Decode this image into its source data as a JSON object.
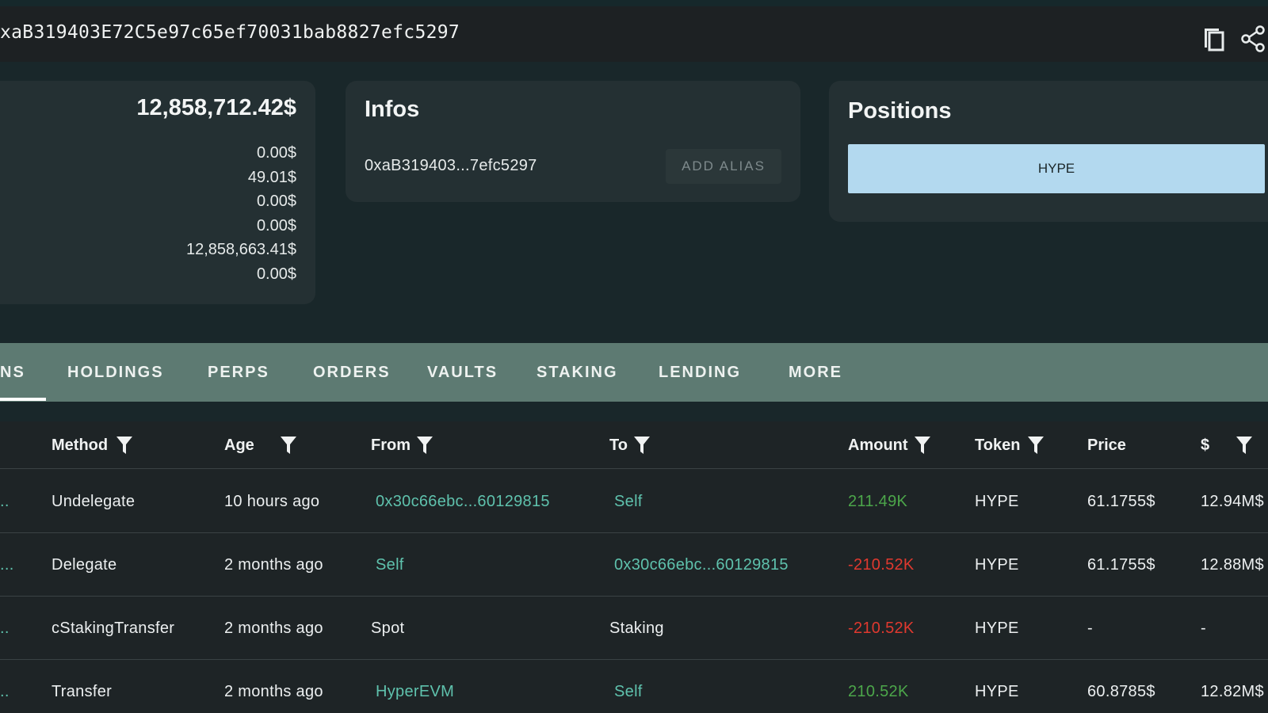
{
  "header": {
    "address": "xaB319403E72C5e97c65ef70031bab8827efc5297",
    "copy_icon": "copy-icon",
    "share_icon": "share-icon"
  },
  "balances": {
    "total": "12,858,712.42$",
    "lines": [
      "0.00$",
      "49.01$",
      "0.00$",
      "0.00$",
      "12,858,663.41$",
      "0.00$"
    ]
  },
  "infos": {
    "title": "Infos",
    "address_short": "0xaB319403...7efc5297",
    "add_alias_label": "ADD ALIAS"
  },
  "positions": {
    "title": "Positions",
    "items": [
      "HYPE"
    ]
  },
  "tabs": [
    {
      "label": "NS",
      "active": true
    },
    {
      "label": "HOLDINGS",
      "active": false
    },
    {
      "label": "PERPS",
      "active": false
    },
    {
      "label": "ORDERS",
      "active": false
    },
    {
      "label": "VAULTS",
      "active": false
    },
    {
      "label": "STAKING",
      "active": false
    },
    {
      "label": "LENDING",
      "active": false
    },
    {
      "label": "MORE",
      "active": false
    }
  ],
  "table": {
    "columns": [
      "Method",
      "Age",
      "From",
      "To",
      "Amount",
      "Token",
      "Price",
      "$"
    ],
    "rows": [
      {
        "hash": "..",
        "method": "Undelegate",
        "age": "10 hours ago",
        "from": "0x30c66ebc...60129815",
        "to": "Self",
        "amount": "211.49K",
        "token": "HYPE",
        "price": "61.1755$",
        "usd": "12.94M$"
      },
      {
        "hash": "...",
        "method": "Delegate",
        "age": "2 months ago",
        "from": "Self",
        "to": "0x30c66ebc...60129815",
        "amount": "-210.52K",
        "token": "HYPE",
        "price": "61.1755$",
        "usd": "12.88M$"
      },
      {
        "hash": "..",
        "method": "cStakingTransfer",
        "age": "2 months ago",
        "from": "Spot",
        "to": "Staking",
        "amount": "-210.52K",
        "token": "HYPE",
        "price": "-",
        "usd": "-"
      },
      {
        "hash": "..",
        "method": "Transfer",
        "age": "2 months ago",
        "from": "HyperEVM",
        "to": "Self",
        "amount": "210.52K",
        "token": "HYPE",
        "price": "60.8785$",
        "usd": "12.82M$"
      }
    ]
  },
  "colors": {
    "link": "#5fc2ad",
    "positive": "#4ca64a",
    "negative": "#e0392f",
    "tabs_bg": "#5d7a72",
    "position_chip": "#b3d9ef"
  }
}
